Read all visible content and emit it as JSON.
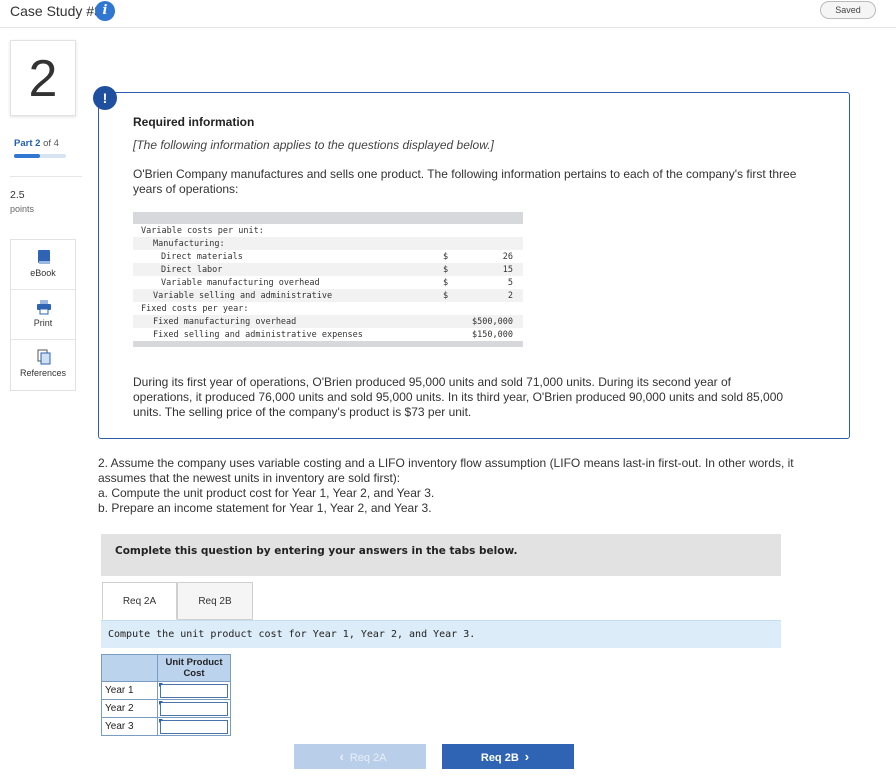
{
  "header": {
    "title": "Case Study #3",
    "info_icon": "info-icon",
    "saved_label": "Saved"
  },
  "rail": {
    "question_number": "2",
    "part_prefix": "Part",
    "part_current": "2",
    "part_of": "of 4",
    "part_progress": 0.5,
    "points_value": "2.5",
    "points_label": "points",
    "tools": [
      {
        "label": "eBook",
        "icon": "book-icon"
      },
      {
        "label": "Print",
        "icon": "printer-icon"
      },
      {
        "label": "References",
        "icon": "references-icon"
      }
    ]
  },
  "required_info": {
    "alert_glyph": "!",
    "title": "Required information",
    "italic_note": "[The following information applies to the questions displayed below.]",
    "intro": "O'Brien Company manufactures and sells one product. The following information pertains to each of the company's first three years of operations:",
    "cost_rows": [
      {
        "label": "Variable costs per unit:",
        "indent": 0,
        "dollar": "",
        "value": ""
      },
      {
        "label": "Manufacturing:",
        "indent": 1,
        "dollar": "",
        "value": ""
      },
      {
        "label": "Direct materials",
        "indent": 2,
        "dollar": "$",
        "value": "26"
      },
      {
        "label": "Direct labor",
        "indent": 2,
        "dollar": "$",
        "value": "15"
      },
      {
        "label": "Variable manufacturing overhead",
        "indent": 2,
        "dollar": "$",
        "value": "5"
      },
      {
        "label": "Variable selling and administrative",
        "indent": 1,
        "dollar": "$",
        "value": "2"
      },
      {
        "label": "Fixed costs per year:",
        "indent": 0,
        "dollar": "",
        "value": ""
      },
      {
        "label": "Fixed manufacturing overhead",
        "indent": 1,
        "dollar": "",
        "value": "$500,000"
      },
      {
        "label": "Fixed selling and administrative expenses",
        "indent": 1,
        "dollar": "",
        "value": "$150,000"
      }
    ],
    "operations": "During its first year of operations, O'Brien produced 95,000 units and sold 71,000 units. During its second year of operations, it produced 76,000 units and sold 95,000 units. In its third year, O'Brien produced 90,000 units and sold 85,000 units. The selling price of the company's product is $73 per unit."
  },
  "question": {
    "line1": "2. Assume the company uses variable costing and a LIFO inventory flow assumption (LIFO means last-in first-out. In other words, it assumes that the newest units in inventory are sold first):",
    "line2": "a. Compute the unit product cost for Year 1, Year 2, and Year 3.",
    "line3": "b. Prepare an income statement for Year 1, Year 2, and Year 3."
  },
  "complete_banner": "Complete this question by entering your answers in the tabs below.",
  "tabs": [
    {
      "label": "Req 2A",
      "active": true
    },
    {
      "label": "Req 2B",
      "active": false
    }
  ],
  "instruction": "Compute the unit product cost for Year 1, Year 2, and Year 3.",
  "answer_table": {
    "column_header": "Unit Product Cost",
    "rows": [
      {
        "label": "Year 1",
        "value": ""
      },
      {
        "label": "Year 2",
        "value": ""
      },
      {
        "label": "Year 3",
        "value": ""
      }
    ]
  },
  "nav": {
    "prev_label": "Req 2A",
    "next_label": "Req 2B",
    "prev_enabled": false
  },
  "colors": {
    "accent": "#2f64b5",
    "panel_border": "#2a5ea8",
    "instruction_bg": "#dcecf8"
  }
}
